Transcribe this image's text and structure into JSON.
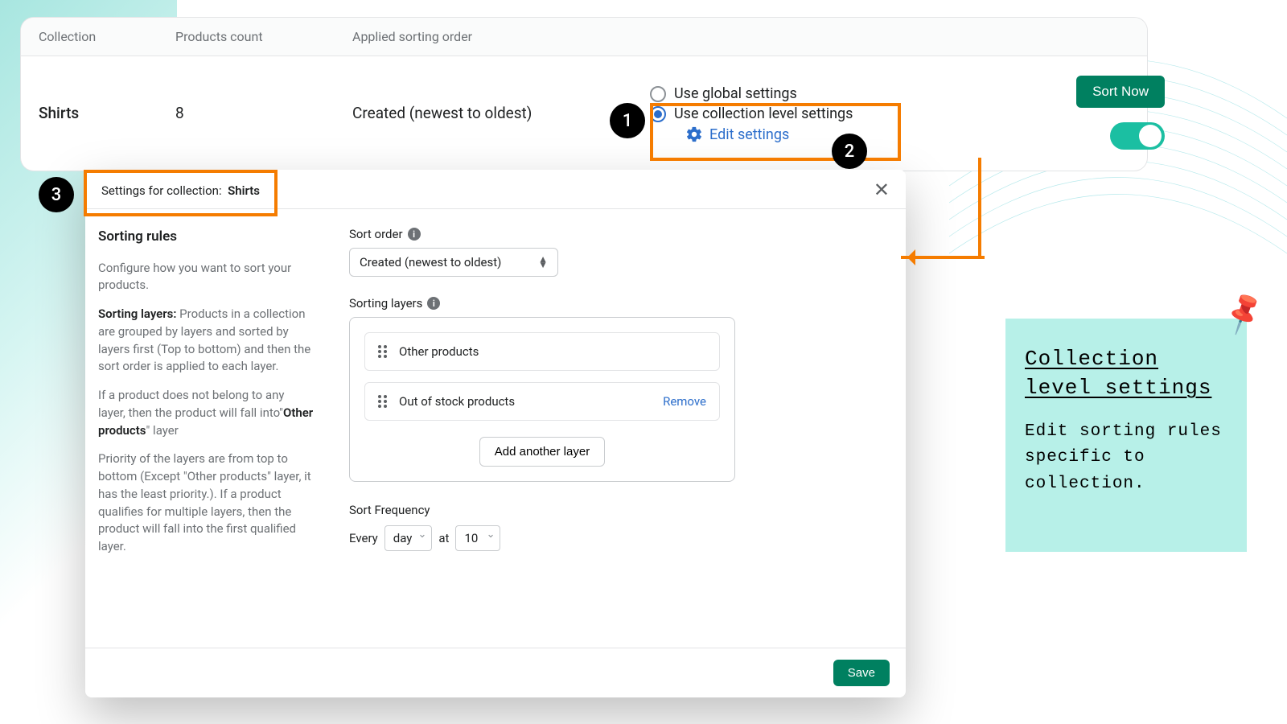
{
  "table": {
    "headers": {
      "collection": "Collection",
      "count": "Products count",
      "order": "Applied sorting order"
    },
    "row": {
      "name": "Shirts",
      "count": "8",
      "order": "Created (newest to oldest)",
      "radio1": "Use global settings",
      "radio2": "Use collection level settings",
      "edit": "Edit settings",
      "sort": "Sort Now"
    }
  },
  "badges": {
    "b1": "1",
    "b2": "2",
    "b3": "3"
  },
  "modal": {
    "title_prefix": "Settings for collection:",
    "title_name": "Shirts",
    "side": {
      "heading": "Sorting rules",
      "p1": "Configure how you want to sort your products.",
      "p2a": "Sorting layers:",
      "p2b": " Products in a collection are grouped by layers and sorted by layers first (Top to bottom) and then the sort order is applied to each layer.",
      "p3a": "If a product does not belong to any layer, then the product will fall into\"",
      "p3b": "Other products",
      "p3c": "\" layer",
      "p4": "Priority of the layers are from top to bottom (Except \"Other products\" layer, it has the least priority.). If a product qualifies for multiple layers, then the product will fall into the first qualified layer."
    },
    "main": {
      "sort_order_label": "Sort order",
      "sort_order_value": "Created (newest to oldest)",
      "layers_label": "Sorting layers",
      "layer1": "Other products",
      "layer2": "Out of stock products",
      "remove": "Remove",
      "add": "Add another layer",
      "freq_label": "Sort Frequency",
      "freq_every": "Every",
      "freq_unit": "day",
      "freq_at": "at",
      "freq_hour": "10"
    },
    "save": "Save"
  },
  "note": {
    "title": "Collection level settings",
    "body": "Edit sorting rules specific to collection."
  }
}
